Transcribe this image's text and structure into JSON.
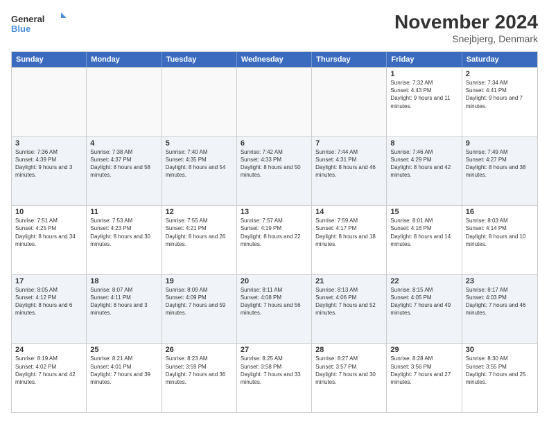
{
  "logo": {
    "line1": "General",
    "line2": "Blue"
  },
  "title": "November 2024",
  "subtitle": "Snejbjerg, Denmark",
  "days": [
    "Sunday",
    "Monday",
    "Tuesday",
    "Wednesday",
    "Thursday",
    "Friday",
    "Saturday"
  ],
  "rows": [
    [
      {
        "day": "",
        "info": ""
      },
      {
        "day": "",
        "info": ""
      },
      {
        "day": "",
        "info": ""
      },
      {
        "day": "",
        "info": ""
      },
      {
        "day": "",
        "info": ""
      },
      {
        "day": "1",
        "info": "Sunrise: 7:32 AM\nSunset: 4:43 PM\nDaylight: 9 hours and 11 minutes."
      },
      {
        "day": "2",
        "info": "Sunrise: 7:34 AM\nSunset: 4:41 PM\nDaylight: 9 hours and 7 minutes."
      }
    ],
    [
      {
        "day": "3",
        "info": "Sunrise: 7:36 AM\nSunset: 4:39 PM\nDaylight: 9 hours and 3 minutes."
      },
      {
        "day": "4",
        "info": "Sunrise: 7:38 AM\nSunset: 4:37 PM\nDaylight: 8 hours and 58 minutes."
      },
      {
        "day": "5",
        "info": "Sunrise: 7:40 AM\nSunset: 4:35 PM\nDaylight: 8 hours and 54 minutes."
      },
      {
        "day": "6",
        "info": "Sunrise: 7:42 AM\nSunset: 4:33 PM\nDaylight: 8 hours and 50 minutes."
      },
      {
        "day": "7",
        "info": "Sunrise: 7:44 AM\nSunset: 4:31 PM\nDaylight: 8 hours and 46 minutes."
      },
      {
        "day": "8",
        "info": "Sunrise: 7:46 AM\nSunset: 4:29 PM\nDaylight: 8 hours and 42 minutes."
      },
      {
        "day": "9",
        "info": "Sunrise: 7:49 AM\nSunset: 4:27 PM\nDaylight: 8 hours and 38 minutes."
      }
    ],
    [
      {
        "day": "10",
        "info": "Sunrise: 7:51 AM\nSunset: 4:25 PM\nDaylight: 8 hours and 34 minutes."
      },
      {
        "day": "11",
        "info": "Sunrise: 7:53 AM\nSunset: 4:23 PM\nDaylight: 8 hours and 30 minutes."
      },
      {
        "day": "12",
        "info": "Sunrise: 7:55 AM\nSunset: 4:21 PM\nDaylight: 8 hours and 26 minutes."
      },
      {
        "day": "13",
        "info": "Sunrise: 7:57 AM\nSunset: 4:19 PM\nDaylight: 8 hours and 22 minutes."
      },
      {
        "day": "14",
        "info": "Sunrise: 7:59 AM\nSunset: 4:17 PM\nDaylight: 8 hours and 18 minutes."
      },
      {
        "day": "15",
        "info": "Sunrise: 8:01 AM\nSunset: 4:16 PM\nDaylight: 8 hours and 14 minutes."
      },
      {
        "day": "16",
        "info": "Sunrise: 8:03 AM\nSunset: 4:14 PM\nDaylight: 8 hours and 10 minutes."
      }
    ],
    [
      {
        "day": "17",
        "info": "Sunrise: 8:05 AM\nSunset: 4:12 PM\nDaylight: 8 hours and 6 minutes."
      },
      {
        "day": "18",
        "info": "Sunrise: 8:07 AM\nSunset: 4:11 PM\nDaylight: 8 hours and 3 minutes."
      },
      {
        "day": "19",
        "info": "Sunrise: 8:09 AM\nSunset: 4:09 PM\nDaylight: 7 hours and 59 minutes."
      },
      {
        "day": "20",
        "info": "Sunrise: 8:11 AM\nSunset: 4:08 PM\nDaylight: 7 hours and 56 minutes."
      },
      {
        "day": "21",
        "info": "Sunrise: 8:13 AM\nSunset: 4:06 PM\nDaylight: 7 hours and 52 minutes."
      },
      {
        "day": "22",
        "info": "Sunrise: 8:15 AM\nSunset: 4:05 PM\nDaylight: 7 hours and 49 minutes."
      },
      {
        "day": "23",
        "info": "Sunrise: 8:17 AM\nSunset: 4:03 PM\nDaylight: 7 hours and 46 minutes."
      }
    ],
    [
      {
        "day": "24",
        "info": "Sunrise: 8:19 AM\nSunset: 4:02 PM\nDaylight: 7 hours and 42 minutes."
      },
      {
        "day": "25",
        "info": "Sunrise: 8:21 AM\nSunset: 4:01 PM\nDaylight: 7 hours and 39 minutes."
      },
      {
        "day": "26",
        "info": "Sunrise: 8:23 AM\nSunset: 3:59 PM\nDaylight: 7 hours and 36 minutes."
      },
      {
        "day": "27",
        "info": "Sunrise: 8:25 AM\nSunset: 3:58 PM\nDaylight: 7 hours and 33 minutes."
      },
      {
        "day": "28",
        "info": "Sunrise: 8:27 AM\nSunset: 3:57 PM\nDaylight: 7 hours and 30 minutes."
      },
      {
        "day": "29",
        "info": "Sunrise: 8:28 AM\nSunset: 3:56 PM\nDaylight: 7 hours and 27 minutes."
      },
      {
        "day": "30",
        "info": "Sunrise: 8:30 AM\nSunset: 3:55 PM\nDaylight: 7 hours and 25 minutes."
      }
    ]
  ]
}
